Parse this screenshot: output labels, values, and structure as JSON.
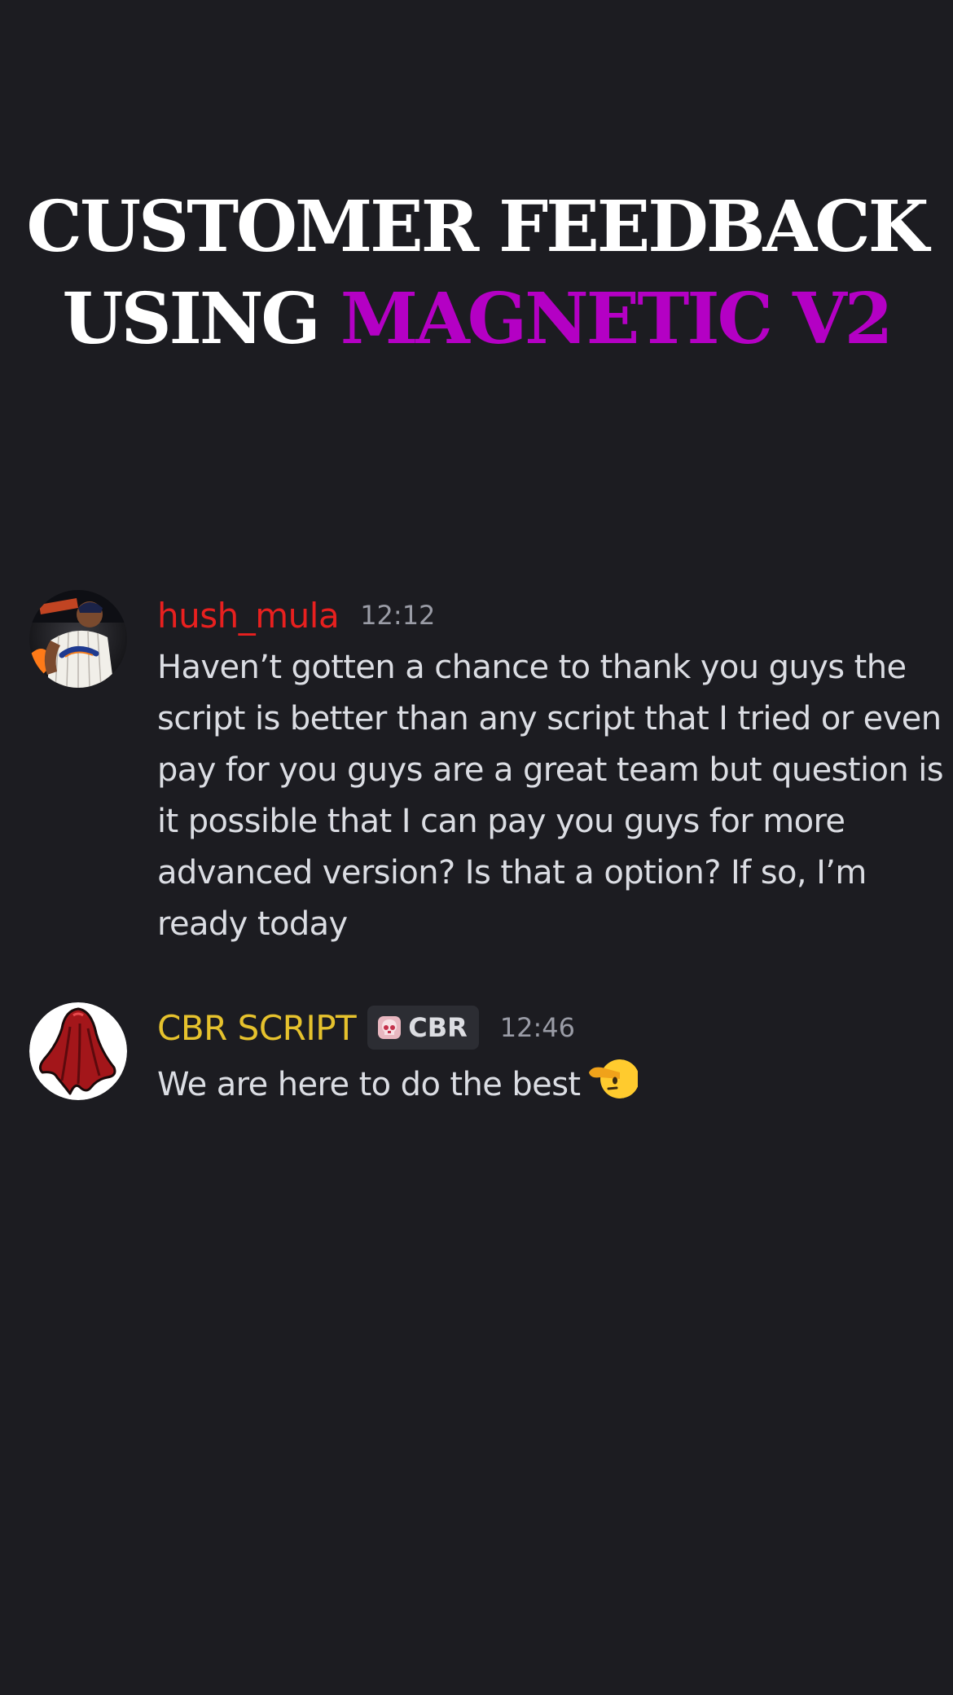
{
  "headline": {
    "line1": "CUSTOMER FEEDBACK",
    "line2_prefix": "USING ",
    "line2_accent": "MAGNETIC V2",
    "accent_color": "#b400c4"
  },
  "messages": [
    {
      "username": "hush_mula",
      "username_color": "#e8201f",
      "timestamp": "12:12",
      "avatar": "baseball-player-avatar",
      "text": "Haven’t gotten a chance to thank you guys the script is better than any script that I tried or even pay for you guys are a great team but question is it possible that I can pay you guys for more advanced version? Is that a option? If so, I’m ready today"
    },
    {
      "username": "CBR SCRIPT",
      "username_color": "#e6c22d",
      "tag_icon": "skull-icon",
      "tag": "CBR",
      "timestamp": "12:46",
      "avatar": "red-cloak-avatar",
      "text": "We are here to do the best",
      "emoji": "saluting-face-emoji"
    }
  ]
}
